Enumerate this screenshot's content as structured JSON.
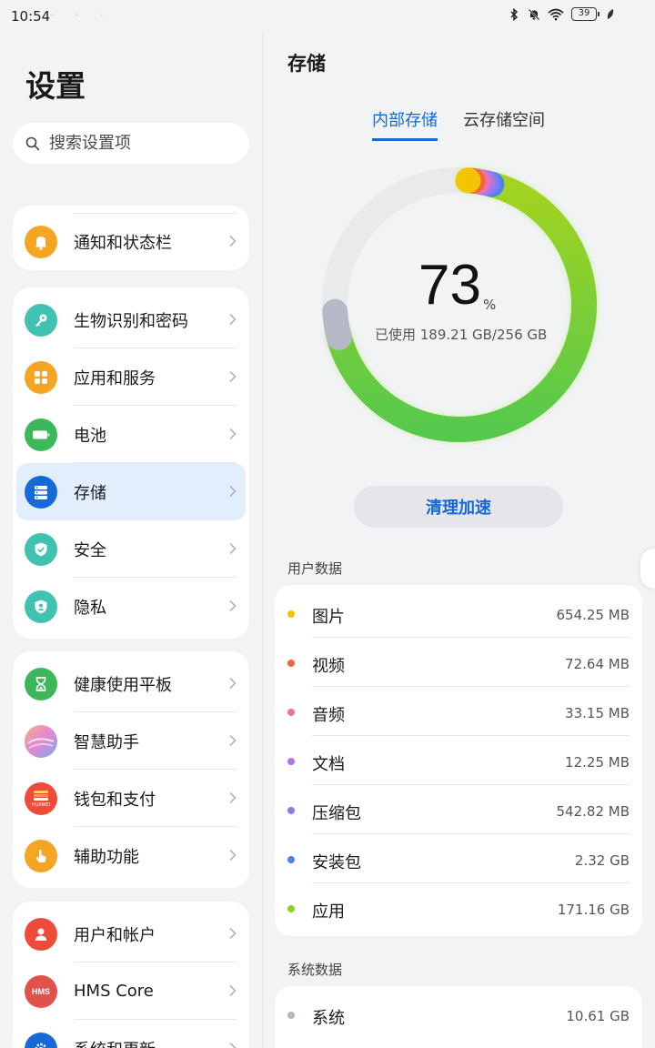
{
  "status_bar": {
    "time": "10:54",
    "notification_dots": "· · ·",
    "icons": [
      "bluetooth-icon",
      "mute-bell-icon",
      "wifi-icon",
      "battery-icon",
      "charging-leaf-icon"
    ],
    "battery_level": "39"
  },
  "left": {
    "title": "设置",
    "search_placeholder": "搜索设置项",
    "groups": [
      [
        {
          "label": "通知和状态栏",
          "icon": "bell-icon",
          "color": "#f5a524"
        }
      ],
      [
        {
          "label": "生物识别和密码",
          "icon": "key-icon",
          "color": "#3fc3b0"
        },
        {
          "label": "应用和服务",
          "icon": "apps-grid-icon",
          "color": "#f5a524"
        },
        {
          "label": "电池",
          "icon": "battery-icon",
          "color": "#3cb85a"
        },
        {
          "label": "存储",
          "icon": "storage-icon",
          "color": "#1669d6",
          "active": true
        },
        {
          "label": "安全",
          "icon": "shield-check-icon",
          "color": "#3fc3b0"
        },
        {
          "label": "隐私",
          "icon": "privacy-shield-icon",
          "color": "#3fc3b0"
        }
      ],
      [
        {
          "label": "健康使用平板",
          "icon": "hourglass-icon",
          "color": "#3cb85a"
        },
        {
          "label": "智慧助手",
          "icon": "assistant-orb-icon",
          "color": "#e48ccd"
        },
        {
          "label": "钱包和支付",
          "icon": "wallet-icon",
          "color": "#ee4b3b",
          "sublabel": "HUAWEI"
        },
        {
          "label": "辅助功能",
          "icon": "hand-pointer-icon",
          "color": "#f5a524"
        }
      ],
      [
        {
          "label": "用户和帐户",
          "icon": "user-icon",
          "color": "#ee4b3b"
        },
        {
          "label": "HMS Core",
          "icon": "hms-icon",
          "color": "#e0524a",
          "badge": "HMS"
        },
        {
          "label": "系统和更新",
          "icon": "gear-icon",
          "color": "#1669d6"
        }
      ]
    ]
  },
  "right": {
    "title": "存储",
    "tabs": [
      {
        "label": "内部存储",
        "active": true
      },
      {
        "label": "云存储空间",
        "active": false
      }
    ],
    "usage_percent": 73,
    "percent_sign": "%",
    "used_text": "已使用 189.21 GB/256 GB",
    "clean_button": "清理加速",
    "user_data_label": "用户数据",
    "user_data": [
      {
        "label": "图片",
        "value": "654.25 MB",
        "color": "#f5c400"
      },
      {
        "label": "视频",
        "value": "72.64 MB",
        "color": "#f0683a"
      },
      {
        "label": "音频",
        "value": "33.15 MB",
        "color": "#ef6fb0"
      },
      {
        "label": "文档",
        "value": "12.25 MB",
        "color": "#b076e8"
      },
      {
        "label": "压缩包",
        "value": "542.82 MB",
        "color": "#7c7ef0"
      },
      {
        "label": "安装包",
        "value": "2.32 GB",
        "color": "#4c83f2"
      },
      {
        "label": "应用",
        "value": "171.16 GB",
        "color": "#8cd224"
      }
    ],
    "system_data_label": "系统数据",
    "system_data": [
      {
        "label": "系统",
        "value": "10.61 GB",
        "color": "#b3b6c2"
      }
    ],
    "ring_colors": {
      "track": "#e9eaec",
      "apps_start": "#a4d41e",
      "apps_end": "#56c94c",
      "system": "#b8b9c6"
    }
  }
}
